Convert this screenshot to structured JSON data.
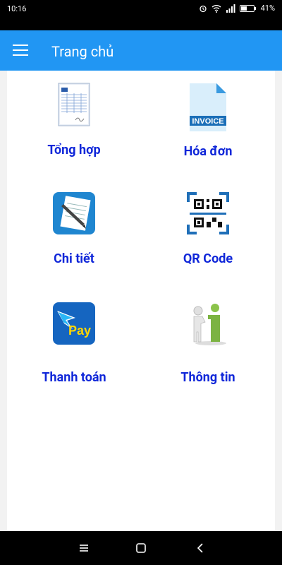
{
  "status": {
    "time": "10:16",
    "battery": "41%"
  },
  "appbar": {
    "title": "Trang chủ",
    "menu_icon": "hamburger-menu-icon"
  },
  "tiles": [
    {
      "label": "Tổng hợp",
      "icon": "report-sheet-icon"
    },
    {
      "label": "Hóa đơn",
      "icon": "invoice-document-icon",
      "icon_text": "INVOICE"
    },
    {
      "label": "Chi tiết",
      "icon": "invoice-detail-icon"
    },
    {
      "label": "QR Code",
      "icon": "qr-code-icon"
    },
    {
      "label": "Thanh toán",
      "icon": "pay-icon",
      "icon_text": "Pay"
    },
    {
      "label": "Thông tin",
      "icon": "info-person-icon"
    }
  ],
  "colors": {
    "appbar": "#2196f3",
    "label": "#1027d9",
    "content_bg": "#ffffff"
  },
  "navbar": {
    "buttons": [
      "recent-apps-icon",
      "home-icon",
      "back-icon"
    ]
  }
}
